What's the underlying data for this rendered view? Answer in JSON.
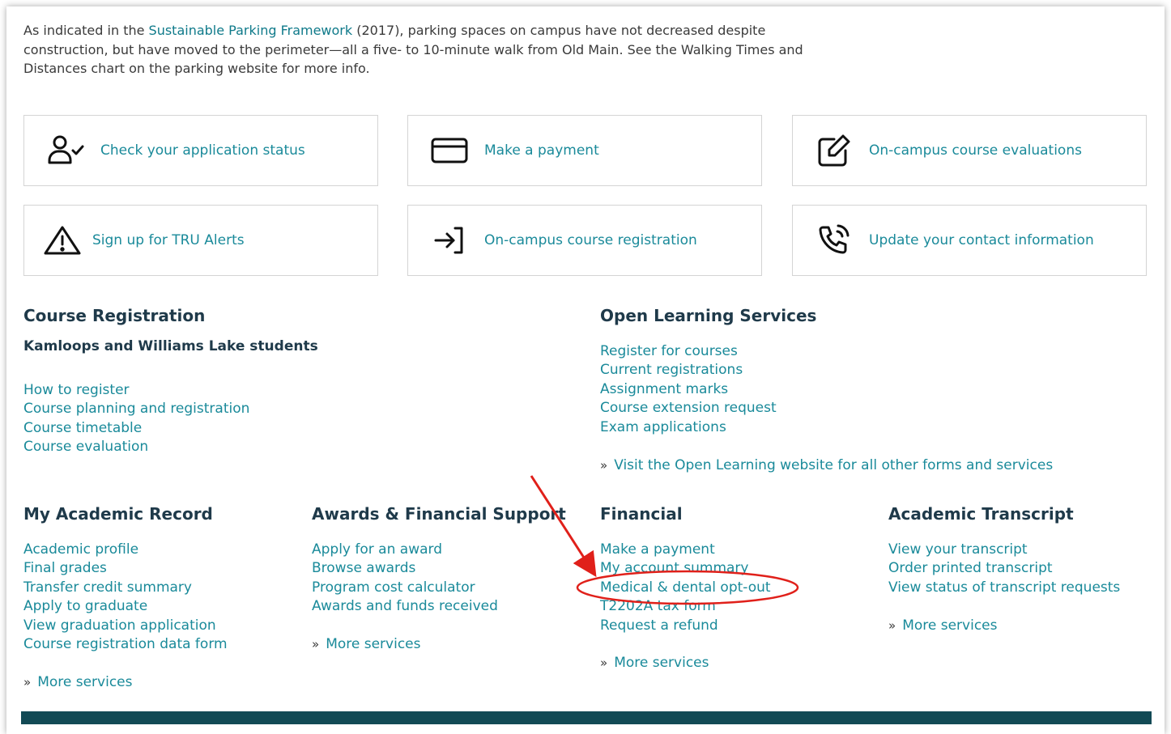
{
  "intro": {
    "before": "As indicated in the ",
    "link": "Sustainable Parking Framework",
    "after": " (2017), parking spaces on campus have not decreased despite construction, but have moved to the perimeter—all a five- to 10-minute walk from Old Main. See the Walking Times and Distances chart on the parking website for more info."
  },
  "cards": [
    {
      "label": "Check your application status",
      "icon": "person-check-icon"
    },
    {
      "label": "Make a payment",
      "icon": "credit-card-icon"
    },
    {
      "label": "On-campus course evaluations",
      "icon": "edit-square-icon"
    },
    {
      "label": "Sign up for TRU Alerts",
      "icon": "warning-icon"
    },
    {
      "label": "On-campus course registration",
      "icon": "login-arrow-icon"
    },
    {
      "label": "Update your contact information",
      "icon": "phone-ringing-icon"
    }
  ],
  "course_registration": {
    "title": "Course Registration",
    "subtitle": "Kamloops and Williams Lake students",
    "links": [
      "How to register",
      "Course planning and registration",
      "Course timetable",
      "Course evaluation"
    ]
  },
  "open_learning": {
    "title": "Open Learning Services",
    "links": [
      "Register for courses",
      "Current registrations",
      "Assignment marks",
      "Course extension request",
      "Exam applications"
    ],
    "more": "Visit the Open Learning website for all other forms and services"
  },
  "academic_record": {
    "title": "My Academic Record",
    "links": [
      "Academic profile",
      "Final grades",
      "Transfer credit summary",
      "Apply to graduate",
      "View graduation application",
      "Course registration data form"
    ],
    "more": "More services"
  },
  "awards": {
    "title": "Awards & Financial Support",
    "links": [
      "Apply for an award",
      "Browse awards",
      "Program cost calculator",
      "Awards and funds received"
    ],
    "more": "More services"
  },
  "financial": {
    "title": "Financial",
    "links": [
      "Make a payment",
      "My account summary",
      "Medical & dental opt-out",
      "T2202A tax form",
      "Request a refund"
    ],
    "more": "More services"
  },
  "transcript": {
    "title": "Academic Transcript",
    "links": [
      "View your transcript",
      "Order printed transcript",
      "View status of transcript requests"
    ],
    "more": "More services"
  },
  "more_glyph": "»",
  "colors": {
    "link": "#1a8a9a",
    "heading": "#1f3a4a",
    "footer": "#124a55",
    "annotation": "#e0201a"
  }
}
